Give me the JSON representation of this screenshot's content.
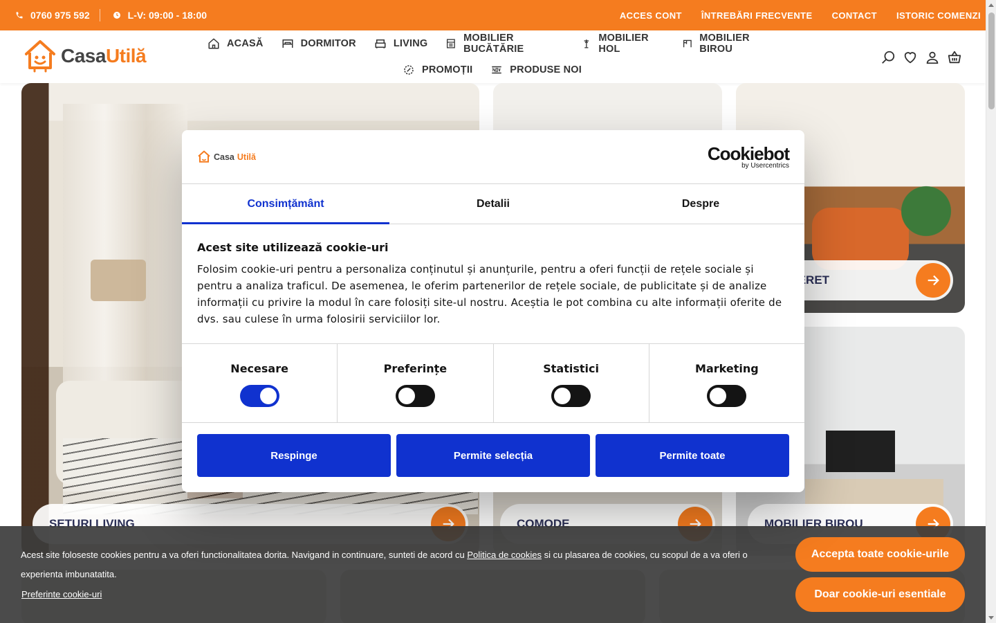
{
  "topbar": {
    "phone": "0760 975 592",
    "hours": "L-V: 09:00 - 18:00",
    "links": [
      "ACCES CONT",
      "ÎNTREBĂRI FRECVENTE",
      "CONTACT",
      "ISTORIC COMENZI"
    ]
  },
  "header": {
    "logo_text_a": "Casa",
    "logo_text_b": "Utilă",
    "nav": [
      "ACASĂ",
      "DORMITOR",
      "LIVING",
      "MOBILIER BUCĂTĂRIE",
      "MOBILIER HOL",
      "MOBILIER BIROU",
      "PROMOȚII",
      "PRODUSE NOI"
    ]
  },
  "tiles": {
    "living": "SETURI LIVING",
    "comode": "COMODE",
    "tineret": "RE TINERET",
    "birou": "MOBILIER BIROU"
  },
  "cookie_modal": {
    "logo_a": "Casa",
    "logo_b": "Utilă",
    "provider": "Cookiebot",
    "provider_sub": "by Usercentrics",
    "tabs": [
      "Consimțământ",
      "Detalii",
      "Despre"
    ],
    "title": "Acest site utilizează cookie-uri",
    "body": "Folosim cookie-uri pentru a personaliza conținutul și anunțurile, pentru a oferi funcții de rețele sociale și pentru a analiza traficul. De asemenea, le oferim partenerilor de rețele sociale, de publicitate și de analize informații cu privire la modul în care folosiți site-ul nostru. Aceștia le pot combina cu alte informații oferite de dvs. sau culese în urma folosirii serviciilor lor.",
    "categories": [
      {
        "label": "Necesare",
        "on": true
      },
      {
        "label": "Preferințe",
        "on": false
      },
      {
        "label": "Statistici",
        "on": false
      },
      {
        "label": "Marketing",
        "on": false
      }
    ],
    "buttons": [
      "Respinge",
      "Permite selecția",
      "Permite toate"
    ]
  },
  "cookie_bar": {
    "text_before": "Acest site foloseste cookies pentru a va oferi functionalitatea dorita. Navigand in continuare, sunteti de acord cu ",
    "link": "Politica de cookies",
    "text_after": " si cu plasarea de cookies, cu scopul de a va oferi o experienta imbunatatita.",
    "preferences": "Preferinte cookie-uri",
    "accept_all": "Accepta toate cookie-urile",
    "essential_only": "Doar cookie-uri esentiale"
  },
  "colors": {
    "brand_orange": "#f57c1f",
    "cookiebot_blue": "#1032cf",
    "text_dark": "#141414"
  }
}
